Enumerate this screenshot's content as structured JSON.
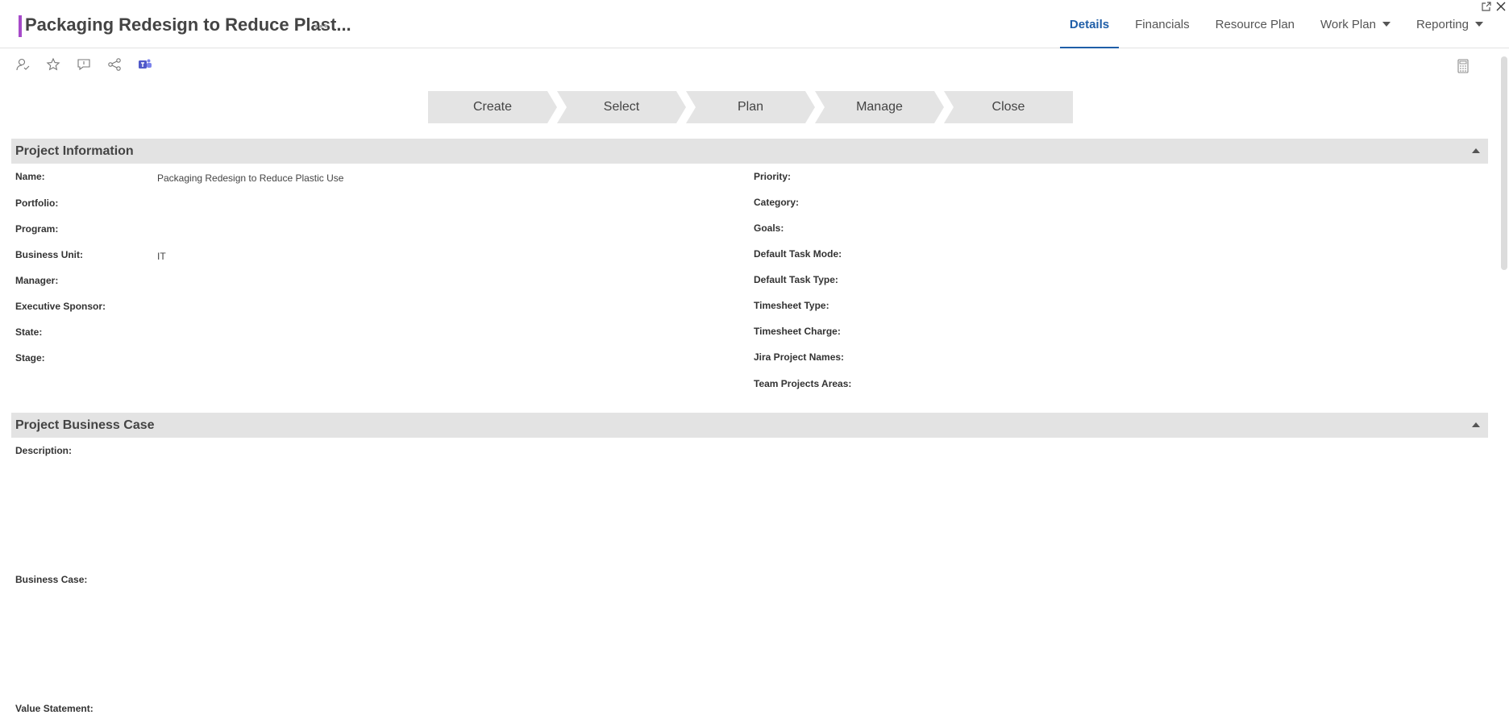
{
  "header": {
    "title": "Packaging Redesign to Reduce Plast...",
    "more": "•••",
    "accent_color": "#a64ac9"
  },
  "nav": {
    "tabs": [
      {
        "label": "Details",
        "active": true
      },
      {
        "label": "Financials"
      },
      {
        "label": "Resource Plan"
      },
      {
        "label": "Work Plan",
        "dropdown": true
      },
      {
        "label": "Reporting",
        "dropdown": true
      }
    ]
  },
  "toolbar": {
    "icons": [
      "user-icon",
      "star-icon",
      "comment-icon",
      "share-icon",
      "teams-icon"
    ],
    "right_icon": "calculator-icon"
  },
  "stages": [
    "Create",
    "Select",
    "Plan",
    "Manage",
    "Close"
  ],
  "project_info": {
    "title": "Project Information",
    "left": [
      {
        "label": "Name:",
        "value": "Packaging Redesign to Reduce Plastic Use"
      },
      {
        "label": "Portfolio:",
        "value": ""
      },
      {
        "label": "Program:",
        "value": ""
      },
      {
        "label": "Business Unit:",
        "value": "IT"
      },
      {
        "label": "Manager:",
        "value": ""
      },
      {
        "label": "Executive Sponsor:",
        "value": ""
      },
      {
        "label": "State:",
        "value": ""
      },
      {
        "label": "Stage:",
        "value": ""
      }
    ],
    "right": [
      {
        "label": "Priority:"
      },
      {
        "label": "Category:"
      },
      {
        "label": "Goals:"
      },
      {
        "label": "Default Task Mode:"
      },
      {
        "label": "Default Task Type:"
      },
      {
        "label": "Timesheet Type:"
      },
      {
        "label": "Timesheet Charge:"
      },
      {
        "label": "Jira Project Names:"
      },
      {
        "label": "Team Projects Areas:"
      }
    ]
  },
  "business_case": {
    "title": "Project Business Case",
    "fields": [
      {
        "label": "Description:"
      },
      {
        "label": "Business Case:"
      },
      {
        "label": "Value Statement:"
      }
    ]
  }
}
